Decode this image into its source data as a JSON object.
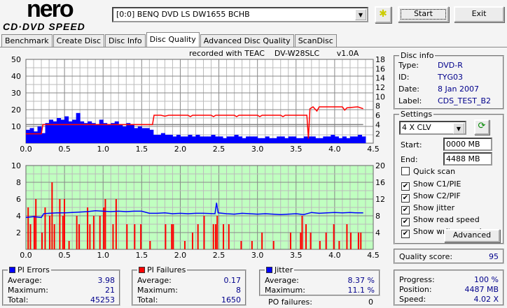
{
  "logo": {
    "line1": "nero",
    "line2": "CD·DVD SPEED"
  },
  "toolbar": {
    "drive": "[0:0]  BENQ DVD LS DW1655 BCHB",
    "start_label": "Start",
    "exit_label": "Exit",
    "refresh_icon": "drive-refresh-icon"
  },
  "tabs": [
    {
      "label": "Benchmark"
    },
    {
      "label": "Create Disc"
    },
    {
      "label": "Disc Info"
    },
    {
      "label": "Disc Quality",
      "active": true
    },
    {
      "label": "Advanced Disc Quality"
    },
    {
      "label": "ScanDisc"
    }
  ],
  "recorded_with": "recorded with TEAC    DV-W28SLC       v1.0A",
  "chart_data": [
    {
      "type": "bar",
      "name_of_chart": "",
      "x_ticks": [
        "0.0",
        "0.5",
        "1.0",
        "1.5",
        "2.0",
        "2.5",
        "3.0",
        "3.5",
        "4.0",
        "4.5"
      ],
      "xlim": [
        0,
        4.5
      ],
      "ylim": [
        0,
        50
      ],
      "y_ticks": [
        "10",
        "20",
        "30",
        "40",
        "50"
      ],
      "y2lim": [
        0,
        18
      ],
      "y2_ticks": [
        "2",
        "4",
        "6",
        "8",
        "10",
        "12",
        "14",
        "16",
        "18"
      ],
      "grid": true,
      "pie_step": 0.05,
      "pie_values": [
        8,
        9,
        7,
        10,
        6,
        12,
        14,
        13,
        15,
        14,
        16,
        13,
        14,
        18,
        13,
        12,
        13,
        12,
        11,
        14,
        12,
        11,
        12,
        13,
        11,
        10,
        12,
        11,
        9,
        10,
        9,
        9,
        8,
        5,
        5,
        6,
        5,
        5,
        4,
        5,
        4,
        4,
        5,
        4,
        5,
        4,
        4,
        4,
        5,
        4,
        4,
        3,
        4,
        4,
        5,
        4,
        3,
        4,
        4,
        4,
        3,
        3,
        4,
        3,
        3,
        4,
        4,
        3,
        4,
        4,
        3,
        3,
        4,
        4,
        4,
        3,
        3,
        4,
        4,
        5,
        4,
        3,
        4,
        3,
        4,
        4,
        5,
        4
      ],
      "read_speed": [
        [
          0,
          2
        ],
        [
          0.2,
          2
        ],
        [
          0.22,
          4
        ],
        [
          1.64,
          4
        ],
        [
          1.66,
          6
        ],
        [
          1.75,
          6
        ],
        [
          1.8,
          5.8
        ],
        [
          1.85,
          6
        ],
        [
          2.1,
          6
        ],
        [
          2.13,
          5.7
        ],
        [
          2.16,
          6
        ],
        [
          2.4,
          6
        ],
        [
          2.43,
          5.7
        ],
        [
          2.46,
          6
        ],
        [
          2.7,
          6
        ],
        [
          2.73,
          5.7
        ],
        [
          2.76,
          6
        ],
        [
          3.0,
          6
        ],
        [
          3.03,
          5.7
        ],
        [
          3.06,
          6
        ],
        [
          3.3,
          6
        ],
        [
          3.33,
          5.7
        ],
        [
          3.36,
          6
        ],
        [
          3.64,
          6
        ],
        [
          3.66,
          1
        ],
        [
          3.68,
          7.4
        ],
        [
          3.72,
          7.8
        ],
        [
          3.77,
          6.9
        ],
        [
          3.8,
          7.8
        ],
        [
          4.1,
          7.8
        ],
        [
          4.13,
          7.1
        ],
        [
          4.16,
          7.6
        ],
        [
          4.3,
          7.8
        ],
        [
          4.37,
          7.4
        ]
      ],
      "write_speed": 4,
      "colors": {
        "pie": "#0000ff",
        "read": "#ff0000",
        "write": "#808080"
      }
    },
    {
      "type": "bar",
      "x_ticks": [
        "0.0",
        "0.5",
        "1.0",
        "1.5",
        "2.0",
        "2.5",
        "3.0",
        "3.5",
        "4.0",
        "4.5"
      ],
      "xlim": [
        0,
        4.5
      ],
      "ylim": [
        0,
        10
      ],
      "y_ticks": [
        "2",
        "4",
        "6",
        "8",
        "10"
      ],
      "y2lim": [
        0,
        20
      ],
      "y2_ticks": [
        "4",
        "8",
        "12",
        "16",
        "20"
      ],
      "grid": true,
      "pif": [
        [
          0.02,
          5
        ],
        [
          0.05,
          3
        ],
        [
          0.1,
          4
        ],
        [
          0.12,
          6
        ],
        [
          0.2,
          2
        ],
        [
          0.24,
          5
        ],
        [
          0.3,
          4
        ],
        [
          0.33,
          8
        ],
        [
          0.36,
          3
        ],
        [
          0.43,
          6
        ],
        [
          0.47,
          4
        ],
        [
          0.49,
          6
        ],
        [
          0.55,
          1
        ],
        [
          0.65,
          4
        ],
        [
          0.68,
          3
        ],
        [
          0.79,
          5
        ],
        [
          0.82,
          3
        ],
        [
          0.87,
          4
        ],
        [
          0.95,
          4
        ],
        [
          1.0,
          5
        ],
        [
          1.02,
          6
        ],
        [
          1.12,
          3
        ],
        [
          1.16,
          6
        ],
        [
          1.3,
          3
        ],
        [
          1.4,
          3
        ],
        [
          1.48,
          3
        ],
        [
          1.6,
          1
        ],
        [
          1.8,
          3
        ],
        [
          1.88,
          3
        ],
        [
          1.9,
          3
        ],
        [
          2.05,
          1
        ],
        [
          2.15,
          2
        ],
        [
          2.22,
          3
        ],
        [
          2.3,
          4
        ],
        [
          2.42,
          3
        ],
        [
          2.45,
          3
        ],
        [
          2.47,
          4
        ],
        [
          2.55,
          3
        ],
        [
          2.62,
          3
        ],
        [
          2.78,
          1
        ],
        [
          2.92,
          1
        ],
        [
          3.05,
          2
        ],
        [
          3.2,
          1
        ],
        [
          3.42,
          2
        ],
        [
          3.55,
          2
        ],
        [
          3.57,
          4
        ],
        [
          3.62,
          3
        ],
        [
          3.68,
          2
        ],
        [
          3.8,
          1
        ],
        [
          3.88,
          2
        ],
        [
          3.98,
          3
        ],
        [
          4.05,
          1
        ],
        [
          4.15,
          3
        ],
        [
          4.2,
          2
        ],
        [
          4.3,
          2
        ],
        [
          4.33,
          2
        ]
      ],
      "jitter": [
        [
          0,
          7.6
        ],
        [
          0.1,
          7.8
        ],
        [
          0.2,
          7.6
        ],
        [
          0.23,
          8.5
        ],
        [
          0.3,
          8.6
        ],
        [
          0.4,
          8.7
        ],
        [
          0.5,
          8.7
        ],
        [
          0.6,
          8.8
        ],
        [
          0.7,
          8.9
        ],
        [
          0.8,
          9.0
        ],
        [
          0.9,
          9.2
        ],
        [
          1.0,
          9.1
        ],
        [
          1.1,
          9.0
        ],
        [
          1.2,
          9.1
        ],
        [
          1.3,
          9.0
        ],
        [
          1.4,
          9.1
        ],
        [
          1.5,
          9.1
        ],
        [
          1.6,
          8.6
        ],
        [
          1.7,
          8.6
        ],
        [
          1.8,
          8.7
        ],
        [
          1.9,
          8.5
        ],
        [
          2.0,
          8.6
        ],
        [
          2.1,
          8.5
        ],
        [
          2.2,
          8.6
        ],
        [
          2.3,
          8.6
        ],
        [
          2.45,
          8.5
        ],
        [
          2.47,
          11.1
        ],
        [
          2.49,
          8.7
        ],
        [
          2.6,
          8.5
        ],
        [
          2.7,
          8.4
        ],
        [
          2.8,
          8.6
        ],
        [
          2.9,
          8.5
        ],
        [
          3.0,
          8.4
        ],
        [
          3.1,
          8.5
        ],
        [
          3.2,
          8.4
        ],
        [
          3.3,
          8.3
        ],
        [
          3.4,
          8.4
        ],
        [
          3.5,
          8.5
        ],
        [
          3.6,
          8.3
        ],
        [
          3.7,
          8.8
        ],
        [
          3.8,
          8.6
        ],
        [
          3.9,
          8.7
        ],
        [
          4.0,
          8.8
        ],
        [
          4.1,
          8.7
        ],
        [
          4.2,
          8.8
        ],
        [
          4.3,
          8.7
        ],
        [
          4.37,
          8.7
        ]
      ],
      "colors": {
        "pif": "#ff0000",
        "jitter": "#0000ff",
        "background": "#c0ffc0"
      }
    }
  ],
  "disc_info": {
    "title": "Disc info",
    "type_label": "Type:",
    "type": "DVD-R",
    "id_label": "ID:",
    "id": "TYG03",
    "date_label": "Date:",
    "date": "8 Jan 2007",
    "label_label": "Label:",
    "label": "CDS_TEST_B2"
  },
  "settings": {
    "title": "Settings",
    "speed": "4 X CLV",
    "start_label": "Start:",
    "start": "0000 MB",
    "end_label": "End:",
    "end": "4488 MB",
    "checks": [
      {
        "label": "Quick scan",
        "checked": false
      },
      {
        "label": "Show C1/PIE",
        "checked": true
      },
      {
        "label": "Show C2/PIF",
        "checked": true
      },
      {
        "label": "Show jitter",
        "checked": true
      },
      {
        "label": "Show read speed",
        "checked": true
      },
      {
        "label": "Show write speed",
        "checked": true
      }
    ],
    "advanced_label": "Advanced"
  },
  "quality": {
    "label": "Quality score:",
    "value": "95"
  },
  "pi_errors": {
    "title": "PI Errors",
    "color": "#0000ff",
    "avg_label": "Average:",
    "avg": "3.98",
    "max_label": "Maximum:",
    "max": "21",
    "total_label": "Total:",
    "total": "45253"
  },
  "pi_failures": {
    "title": "PI Failures",
    "color": "#ff0000",
    "avg_label": "Average:",
    "avg": "0.17",
    "max_label": "Maximum:",
    "max": "8",
    "total_label": "Total:",
    "total": "1650"
  },
  "jitter": {
    "title": "Jitter",
    "color": "#0000ff",
    "avg_label": "Average:",
    "avg": "8.37 %",
    "max_label": "Maximum:",
    "max": "11.1 %",
    "po_label": "PO failures:",
    "po": "0"
  },
  "progress": {
    "progress_label": "Progress:",
    "progress": "100 %",
    "position_label": "Position:",
    "position": "4487 MB",
    "speed_label": "Speed:",
    "speed": "4.02 X"
  }
}
